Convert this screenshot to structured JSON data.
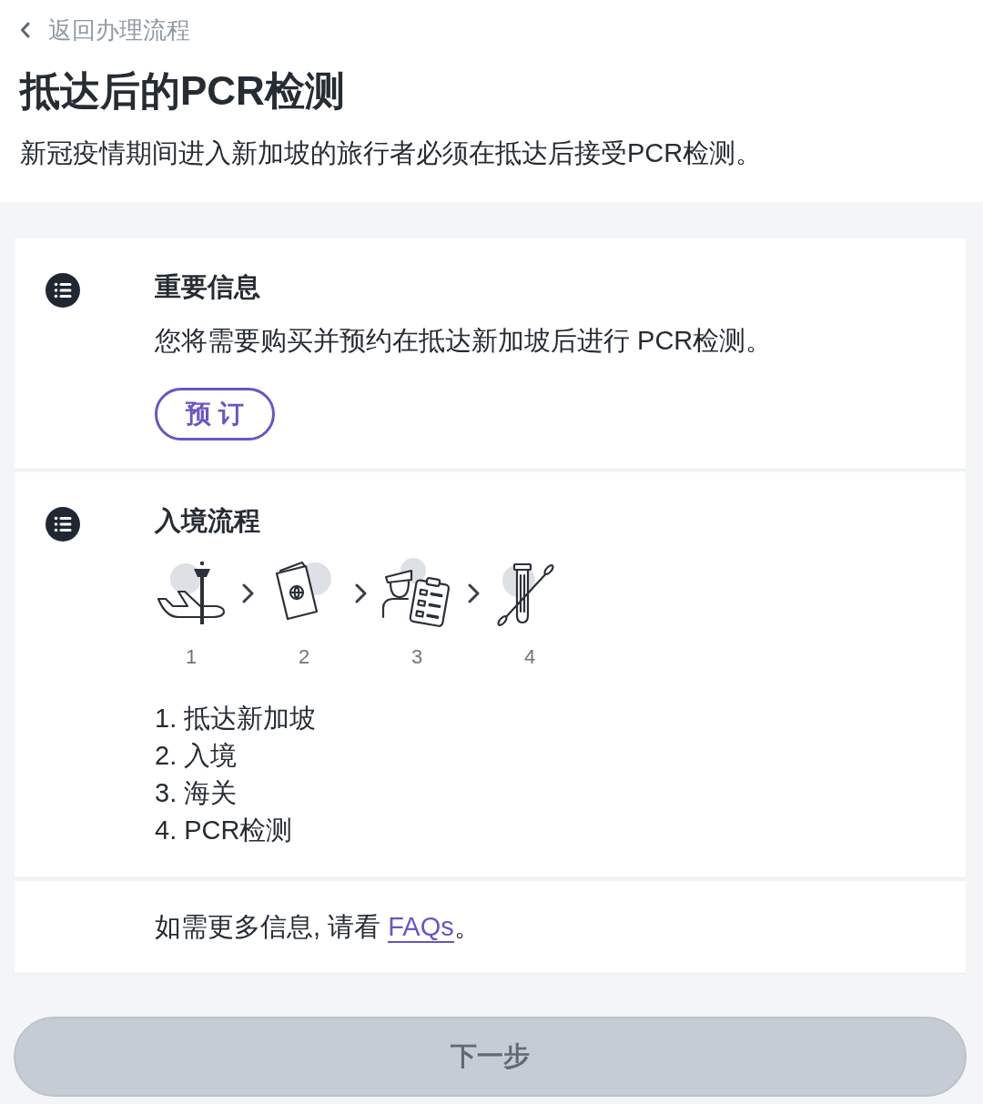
{
  "back_link": {
    "label": "返回办理流程"
  },
  "header": {
    "title": "抵达后的PCR检测",
    "subtitle": "新冠疫情期间进入新加坡的旅行者必须在抵达后接受PCR检测。"
  },
  "important_info": {
    "title": "重要信息",
    "body": "您将需要购买并预约在抵达新加坡后进行 PCR检测。",
    "button": "预 订"
  },
  "entry_process": {
    "title": "入境流程",
    "steps": [
      {
        "kind": "arrival",
        "number": "1"
      },
      {
        "kind": "passport",
        "number": "2"
      },
      {
        "kind": "customs",
        "number": "3"
      },
      {
        "kind": "test",
        "number": "4"
      }
    ],
    "list": [
      "1. 抵达新加坡",
      "2. 入境",
      "3. 海关",
      "4. PCR检测"
    ]
  },
  "more_info": {
    "text": "如需更多信息, 请看",
    "link": "FAQs",
    "after": "。"
  },
  "next_button": {
    "label": "下一步",
    "disabled": true
  }
}
